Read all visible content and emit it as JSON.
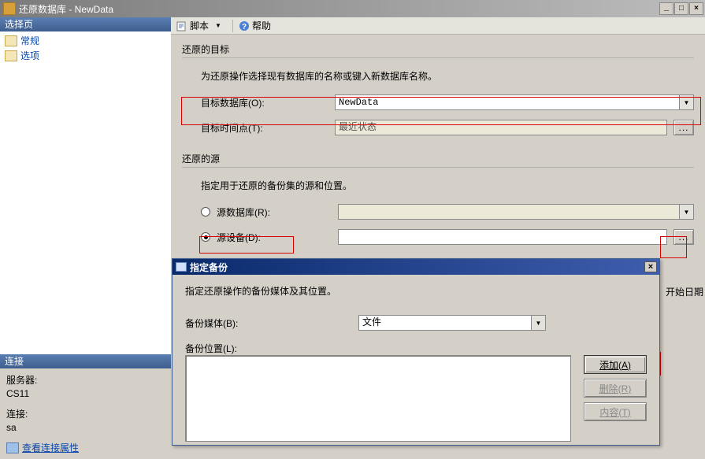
{
  "window": {
    "title": "还原数据库 - NewData",
    "btn_min": "_",
    "btn_max": "□",
    "btn_close": "×"
  },
  "left": {
    "select_header": "选择页",
    "nav": {
      "general": "常规",
      "options": "选项"
    },
    "conn_header": "连接",
    "server_label": "服务器:",
    "server_value": "CS11",
    "conn_label": "连接:",
    "conn_value": "sa",
    "view_conn_props": "查看连接属性"
  },
  "toolbar": {
    "script": "脚本",
    "help": "帮助",
    "dropdown_glyph": "▼"
  },
  "form": {
    "dest_group": "还原的目标",
    "dest_instruction": "为还原操作选择现有数据库的名称或键入新数据库名称。",
    "target_db_label": "目标数据库(O):",
    "target_db_value": "NewData",
    "target_time_label": "目标时间点(T):",
    "target_time_value": "最近状态",
    "ellipsis": "...",
    "source_group": "还原的源",
    "source_instruction": "指定用于还原的备份集的源和位置。",
    "radio_db_label": "源数据库(R):",
    "radio_device_label": "源设备(D):",
    "dropdown_glyph": "▼",
    "frag_text": "开始日期"
  },
  "dialog": {
    "title": "指定备份",
    "close": "×",
    "instruction": "指定还原操作的备份媒体及其位置。",
    "media_label": "备份媒体(B):",
    "media_value": "文件",
    "location_label": "备份位置(L):",
    "btn_add": "添加(A)",
    "btn_remove": "删除(R)",
    "btn_contents": "内容(T)",
    "dropdown_glyph": "▼"
  }
}
